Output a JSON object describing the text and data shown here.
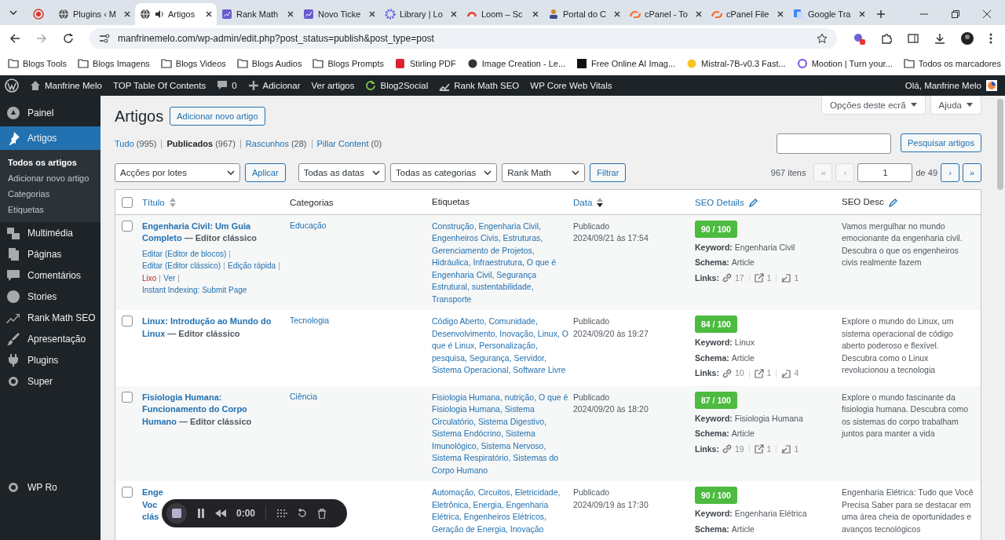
{
  "browser": {
    "tabs": [
      {
        "selected": false
      },
      {
        "label": "Plugins ‹ M",
        "selected": false
      },
      {
        "label": "Artigos",
        "selected": true,
        "audio": true
      },
      {
        "label": "Rank Math",
        "selected": false
      },
      {
        "label": "Novo Ticke",
        "selected": false
      },
      {
        "label": "Library | Lo",
        "selected": false
      },
      {
        "label": "Loom – Sc",
        "selected": false
      },
      {
        "label": "Portal do C",
        "selected": false
      },
      {
        "label": "cPanel - To",
        "selected": false
      },
      {
        "label": "cPanel File",
        "selected": false
      },
      {
        "label": "Google Tra",
        "selected": false
      }
    ],
    "url": "manfrinemelo.com/wp-admin/edit.php?post_status=publish&post_type=post",
    "bookmarks": [
      "Blogs Tools",
      "Blogs Imagens",
      "Blogs Videos",
      "Blogs Audios",
      "Blogs Prompts",
      "Stirling PDF",
      "Image Creation - Le...",
      "Free Online AI Imag...",
      "Mistral-7B-v0.3 Fast...",
      "Mootion | Turn your..."
    ],
    "all_bookmarks": "Todos os marcadores"
  },
  "admin_bar": {
    "items": [
      "Manfrine Melo",
      "TOP Table Of Contents",
      "0",
      "Adicionar",
      "Ver artigos",
      "Blog2Social",
      "Rank Math SEO",
      "WP Core Web Vitals"
    ],
    "greeting": "Olá, Manfrine Melo"
  },
  "sidebar": {
    "items": [
      {
        "label": "Painel",
        "selected": false
      },
      {
        "label": "Artigos",
        "selected": true,
        "children": [
          {
            "label": "Todos os artigos",
            "selected": true
          },
          {
            "label": "Adicionar novo artigo",
            "selected": false
          },
          {
            "label": "Categorias",
            "selected": false
          },
          {
            "label": "Etiquetas",
            "selected": false
          }
        ]
      },
      {
        "label": "Multimédia",
        "selected": false
      },
      {
        "label": "Páginas",
        "selected": false
      },
      {
        "label": "Comentários",
        "selected": false
      },
      {
        "label": "Stories",
        "selected": false
      },
      {
        "label": "Rank Math SEO",
        "selected": false
      },
      {
        "label": "Apresentação",
        "selected": false
      },
      {
        "label": "Plugins",
        "selected": false
      },
      {
        "label": "Super",
        "selected": false
      }
    ],
    "bottom_item": "WP Ro"
  },
  "screen_options": "Opções deste ecrã",
  "help": "Ajuda",
  "page_title": "Artigos",
  "add_new": "Adicionar novo artigo",
  "status_filters": [
    {
      "label": "Tudo",
      "count": "(995)",
      "selected": false
    },
    {
      "label": "Publicados",
      "count": "(967)",
      "selected": true
    },
    {
      "label": "Rascunhos",
      "count": "(28)",
      "selected": false
    },
    {
      "label": "Pillar Content",
      "count": "(0)",
      "selected": false
    }
  ],
  "search_button": "Pesquisar artigos",
  "bulk_action": "Acções por lotes",
  "apply": "Aplicar",
  "filters": [
    "Todas as datas",
    "Todas as categorias",
    "Rank Math"
  ],
  "filter_button": "Filtrar",
  "pagination": {
    "count": "967 itens",
    "first": "«",
    "prev": "‹",
    "page": "1",
    "of": "de 49",
    "next": "›",
    "last": "»",
    "first_disabled": true,
    "next_disabled": false
  },
  "table": {
    "select_all": {
      "checked": false
    },
    "columns": [
      {
        "label": "Título",
        "kind": "sortable"
      },
      {
        "label": "Categorias",
        "kind": "plain"
      },
      {
        "label": "Etiquetas",
        "kind": "plain"
      },
      {
        "label": "Data",
        "kind": "sorted"
      },
      {
        "label": "SEO Details",
        "kind": "editable-link"
      },
      {
        "label": "SEO Desc",
        "kind": "editable"
      }
    ],
    "rows": [
      {
        "checked": false,
        "title": "Engenharia Civil: Um Guia Completo",
        "suffix": "— Editor clássico",
        "actions": [
          {
            "label": "Editar (Editor de blocos)",
            "kind": "link"
          },
          {
            "label": "Editar (Editor clássico)",
            "kind": "link"
          },
          {
            "label": "Edição rápida",
            "kind": "link"
          },
          {
            "label": "Lixo",
            "kind": "delete"
          },
          {
            "label": "Ver",
            "kind": "link"
          },
          {
            "label": "Instant Indexing: Submit Page",
            "kind": "link"
          }
        ],
        "category": "Educação",
        "tags": "Construção, Engenharia Civil, Engenheiros Civis, Estruturas, Gerenciamento de Projetos, Hidráulica, Infraestrutura, O que é Engenharia Civil, Segurança Estrutural, sustentabilidade, Transporte",
        "status": "Publicado",
        "date": "2024/09/21 às 17:54",
        "score": "90 / 100",
        "keyword_label": "Keyword:",
        "keyword": "Engenharia Civil",
        "schema_label": "Schema:",
        "schema": "Article",
        "links_label": "Links:",
        "links": [
          "17",
          "1",
          "1"
        ],
        "desc": "Vamos mergulhar no mundo emocionante da engenharia civil. Descubra o que os engenheiros civis realmente fazem"
      },
      {
        "checked": false,
        "title": "Linux: Introdução ao Mundo do Linux",
        "suffix": "— Editor clássico",
        "category": "Tecnologia",
        "tags": "Código Aberto, Comunidade, Desenvolvimento, Inovação, Linux, O que é Linux, Personalização, pesquisa, Segurança, Servidor, Sistema Operacional, Software Livre",
        "status": "Publicado",
        "date": "2024/09/20 às 19:27",
        "score": "84 / 100",
        "keyword_label": "Keyword:",
        "keyword": "Linux",
        "schema_label": "Schema:",
        "schema": "Article",
        "links_label": "Links:",
        "links": [
          "10",
          "1",
          "4"
        ],
        "desc": "Explore o mundo do Linux, um sistema operacional de código aberto poderoso e flexível. Descubra como o Linux revolucionou a tecnologia"
      },
      {
        "checked": false,
        "title": "Fisiologia Humana: Funcionamento do Corpo Humano",
        "suffix": "— Editor clássico",
        "category": "Ciência",
        "tags": "Fisiologia Humana, nutrição, O que é Fisiologia Humana, Sistema Circulatório, Sistema Digestivo, Sistema Endócrino, Sistema Imunológico, Sistema Nervoso, Sistema Respiratório, Sistemas do Corpo Humano",
        "status": "Publicado",
        "date": "2024/09/20 às 18:20",
        "score": "87 / 100",
        "keyword_label": "Keyword:",
        "keyword": "Fisiologia Humana",
        "schema_label": "Schema:",
        "schema": "Article",
        "links_label": "Links:",
        "links": [
          "19",
          "1",
          "1"
        ],
        "desc": "Explore o mundo fascinante da fisiologia humana. Descubra como os sistemas do corpo trabalham juntos para manter a vida"
      },
      {
        "checked": false,
        "title_fragments": [
          "Enge",
          "Voc",
          "clás"
        ],
        "tags": "Automação, Circuitos, Eletricidade, Eletrônica, Energia, Engenharia Elétrica, Engenheiros Elétricos, Geração de Energia, Inovação",
        "status": "Publicado",
        "date": "2024/09/19 às 17:30",
        "score": "90 / 100",
        "keyword_label": "Keyword:",
        "keyword": "Engenharia Elétrica",
        "schema_label": "Schema:",
        "schema": "Article",
        "desc": "Engenharia Elétrica: Tudo que Você Precisa Saber para se destacar em uma área cheia de oportunidades e avanços tecnológicos"
      }
    ]
  },
  "recorder": {
    "time": "0:00"
  }
}
